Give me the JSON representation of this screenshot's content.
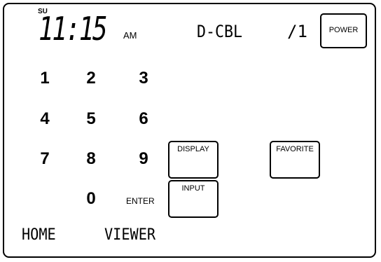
{
  "status": {
    "day": "SU",
    "time": "11:15",
    "ampm": "AM",
    "source": "D-CBL",
    "page": "/1"
  },
  "keypad": [
    "1",
    "2",
    "3",
    "4",
    "5",
    "6",
    "7",
    "8",
    "9",
    "0"
  ],
  "labels": {
    "enter": "ENTER"
  },
  "buttons": {
    "power": "POWER",
    "display": "DISPLAY",
    "favorite": "FAVORITE",
    "input": "INPUT"
  },
  "bottom": {
    "home": "HOME",
    "viewer": "VIEWER"
  }
}
